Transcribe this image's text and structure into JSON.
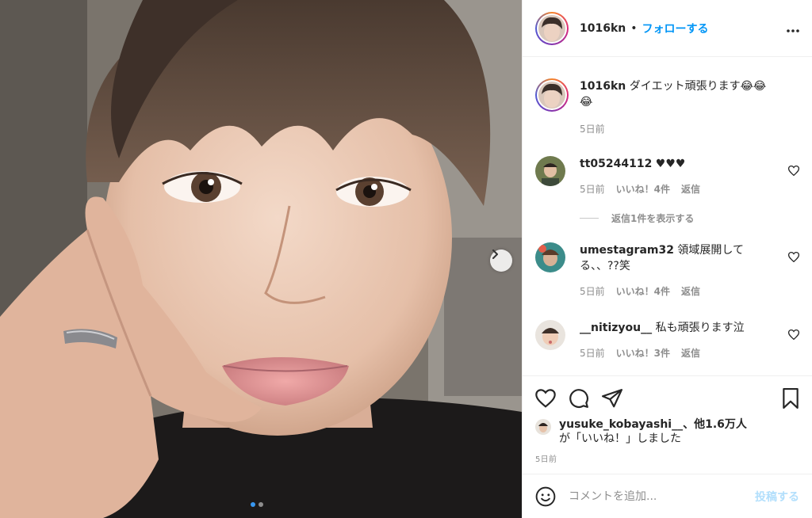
{
  "post": {
    "username": "1016kn",
    "separator": "•",
    "follow_label": "フォローする",
    "more_icon": "more-horizontal-icon"
  },
  "caption": {
    "username": "1016kn",
    "text": "ダイエット頑張ります😂😂😂",
    "time": "5日前"
  },
  "comments": [
    {
      "username": "tt05244112",
      "text": "♥♥♥",
      "time": "5日前",
      "likes": "いいね！4件",
      "reply": "返信",
      "view_replies": "返信1件を表示する"
    },
    {
      "username": "umestagram32",
      "text": "領域展開してる、、??笑",
      "time": "5日前",
      "likes": "いいね！4件",
      "reply": "返信"
    },
    {
      "username": "__nitizyou__",
      "text": "私も頑張ります泣",
      "time": "5日前",
      "likes": "いいね！3件",
      "reply": "返信"
    }
  ],
  "liked_by": {
    "username": "yusuke_kobayashi__",
    "rest": "、他1.6万人",
    "suffix": "が「いいね！」しました"
  },
  "post_time": "5日前",
  "comment_box": {
    "placeholder": "コメントを追加...",
    "post_label": "投稿する"
  },
  "carousel": {
    "current": 1,
    "total": 2
  },
  "colors": {
    "accent": "#0095f6",
    "disabled_post": "#b2dffc",
    "muted": "#8e8e8e"
  }
}
